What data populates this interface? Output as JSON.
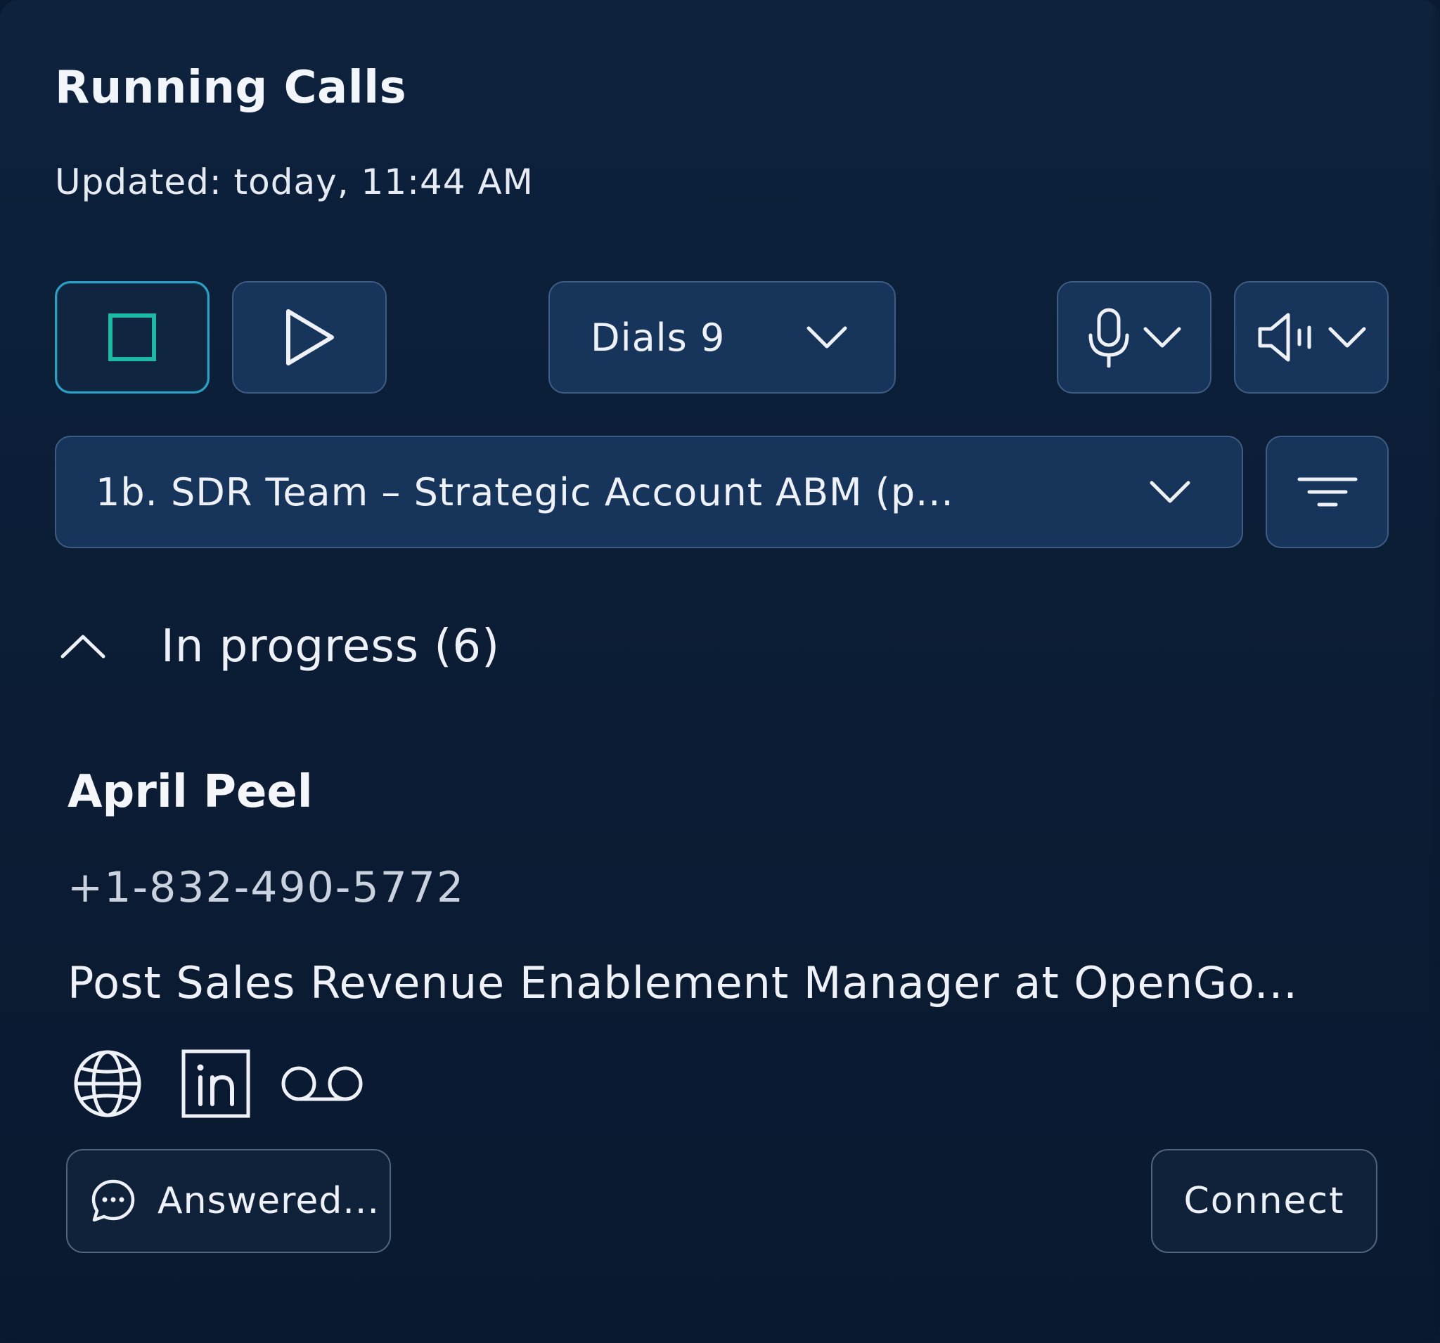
{
  "panel": {
    "title": "Running Calls",
    "updated": "Updated: today, 11:44 AM"
  },
  "toolbar": {
    "dials_label": "Dials 9"
  },
  "list_select": {
    "label": "1b. SDR Team – Strategic Account ABM (p..."
  },
  "section": {
    "label": "In progress (6)",
    "expanded": true
  },
  "contact": {
    "name": "April Peel",
    "phone": "+1-832-490-5772",
    "role": "Post Sales Revenue Enablement Manager at OpenGo...",
    "actions": {
      "answered_label": "Answered...",
      "connect_label": "Connect"
    }
  },
  "icons": {
    "stop": "stop-icon",
    "play": "play-icon",
    "dials_chevron": "chevron-down-icon",
    "mic": "microphone-icon",
    "speaker": "speaker-icon",
    "list_chevron": "chevron-down-icon",
    "filter": "filter-icon",
    "section_chevron": "chevron-up-icon",
    "globe": "globe-icon",
    "linkedin": "linkedin-icon",
    "voicemail": "voicemail-icon",
    "chat": "chat-bubble-icon"
  },
  "colors": {
    "background": "#0b1c34",
    "button_fill": "#17345a",
    "button_border": "#3f5c82",
    "stop_accent": "#1fb8a5",
    "stop_border": "#2f9fc8",
    "text": "#eef2f8",
    "muted_text": "#c9d2de"
  }
}
